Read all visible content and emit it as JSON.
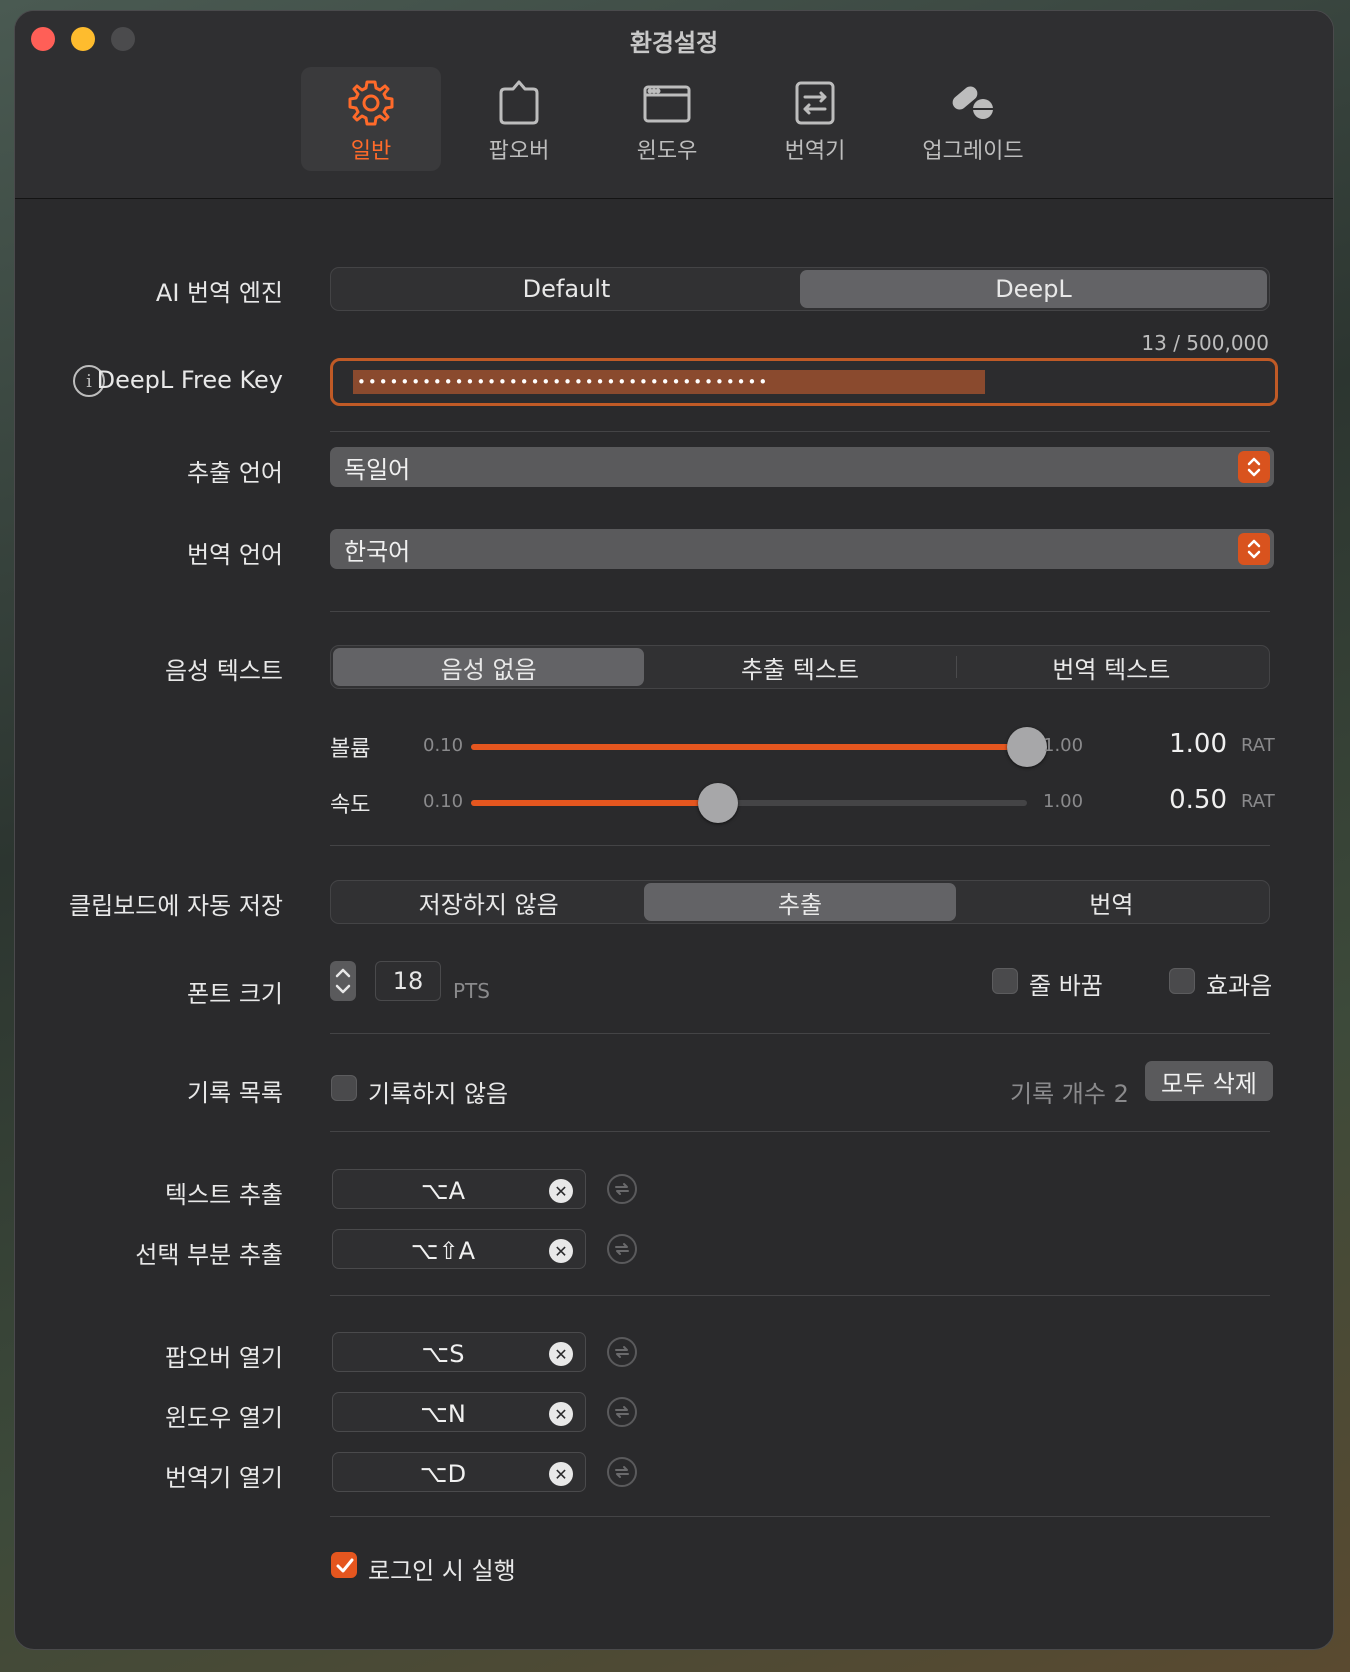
{
  "window": {
    "title": "환경설정"
  },
  "tabs": [
    {
      "label": "일반",
      "icon": "gear-icon",
      "active": true
    },
    {
      "label": "팝오버",
      "icon": "popover-icon",
      "active": false
    },
    {
      "label": "윈도우",
      "icon": "window-icon",
      "active": false
    },
    {
      "label": "번역기",
      "icon": "translator-icon",
      "active": false
    },
    {
      "label": "업그레이드",
      "icon": "pills-icon",
      "active": false
    }
  ],
  "engine": {
    "label": "AI 번역 엔진",
    "options": [
      "Default",
      "DeepL"
    ],
    "selected": "DeepL"
  },
  "deepl": {
    "label": "DeepL Free Key",
    "usage": "13 / 500,000",
    "value": "••••••••••••••••••••••••••••••••••••••"
  },
  "source_lang": {
    "label": "추출 언어",
    "value": "독일어"
  },
  "target_lang": {
    "label": "번역 언어",
    "value": "한국어"
  },
  "voice": {
    "label": "음성 텍스트",
    "options": [
      "음성 없음",
      "추출 텍스트",
      "번역 텍스트"
    ],
    "selected": "음성 없음"
  },
  "volume": {
    "label": "볼륨",
    "min": "0.10",
    "max": "1.00",
    "value": "1.00",
    "unit": "RAT",
    "fraction": 1.0
  },
  "speed": {
    "label": "속도",
    "min": "0.10",
    "max": "1.00",
    "value": "0.50",
    "unit": "RAT",
    "fraction": 0.444
  },
  "clipboard": {
    "label": "클립보드에 자동 저장",
    "options": [
      "저장하지 않음",
      "추출",
      "번역"
    ],
    "selected": "추출"
  },
  "font": {
    "label": "폰트 크기",
    "value": "18",
    "unit": "PTS"
  },
  "wrap": {
    "label": "줄 바꿈",
    "checked": false
  },
  "sound": {
    "label": "효과음",
    "checked": false
  },
  "history": {
    "label": "기록 목록",
    "disable_label": "기록하지 않음",
    "count_text": "기록 개수 2",
    "clear_button": "모두 삭제"
  },
  "shortcuts": [
    {
      "label": "텍스트 추출",
      "keys": "⌥A"
    },
    {
      "label": "선택 부분 추출",
      "keys": "⌥⇧A"
    },
    {
      "label": "팝오버 열기",
      "keys": "⌥S"
    },
    {
      "label": "윈도우 열기",
      "keys": "⌥N"
    },
    {
      "label": "번역기 열기",
      "keys": "⌥D"
    }
  ],
  "login": {
    "label": "로그인 시 실행",
    "checked": true
  },
  "colors": {
    "accent": "#e5561f",
    "window_bg": "#2a2a2c"
  }
}
